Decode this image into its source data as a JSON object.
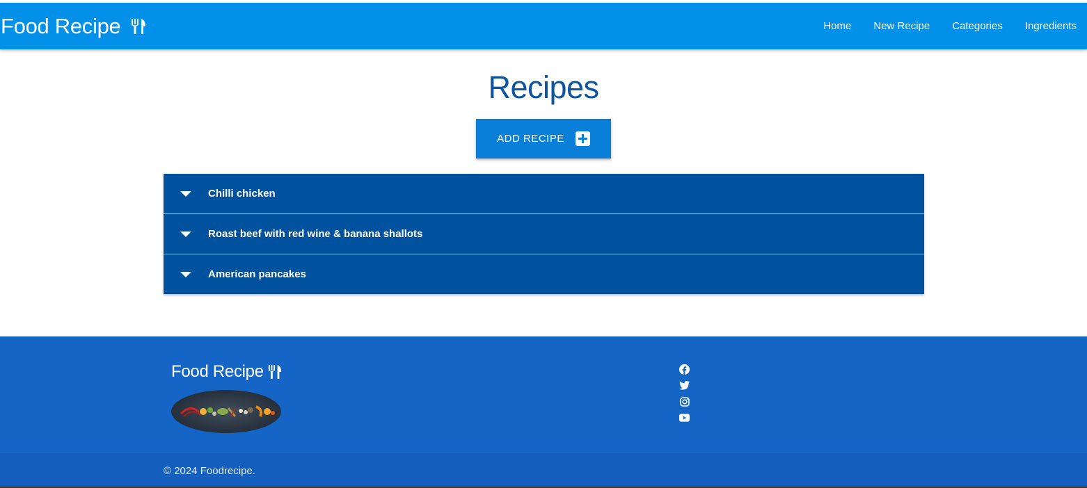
{
  "navbar": {
    "brand": "Food Recipe",
    "links": [
      "Home",
      "New Recipe",
      "Categories",
      "Ingredients"
    ]
  },
  "main": {
    "title": "Recipes",
    "add_button_label": "ADD RECIPE",
    "recipes": [
      "Chilli chicken",
      "Roast beef with red wine & banana shallots",
      "American pancakes"
    ]
  },
  "footer": {
    "brand": "Food Recipe",
    "social_icons": [
      "facebook-icon",
      "twitter-icon",
      "instagram-icon",
      "youtube-icon"
    ],
    "copyright": "© 2024 Foodrecipe."
  },
  "colors": {
    "navbar": "#0390e8",
    "title": "#0d55a0",
    "button": "#0a7fd8",
    "accordion": "#00529e",
    "footer": "#1565c6"
  }
}
